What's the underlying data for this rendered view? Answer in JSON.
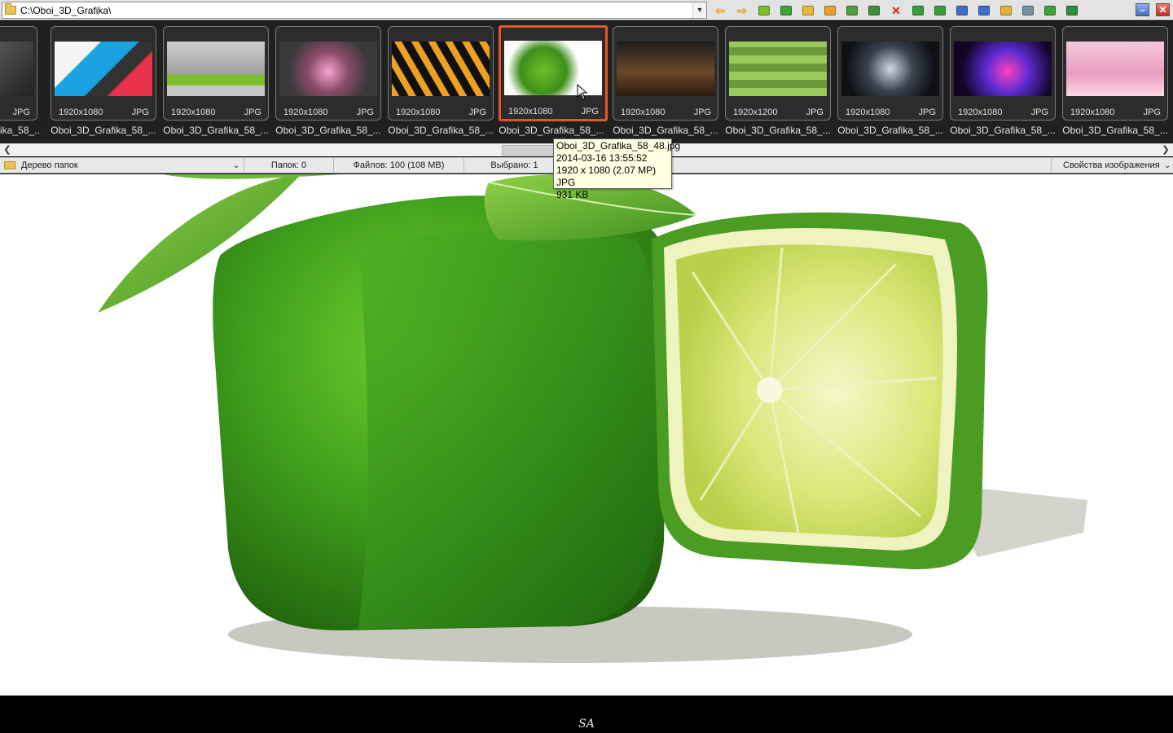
{
  "address_bar": {
    "path": "C:\\Oboi_3D_Grafika\\"
  },
  "toolbar": {
    "buttons": [
      {
        "name": "back-icon",
        "glyph": "⇦",
        "color": "#e0a500"
      },
      {
        "name": "forward-icon",
        "glyph": "⇨",
        "color": "#e0a500"
      },
      {
        "name": "up-folder-icon",
        "glyph": "",
        "color": "#7dbd2e"
      },
      {
        "name": "refresh-icon",
        "glyph": "",
        "color": "#3fa23a"
      },
      {
        "name": "folder-star-icon",
        "glyph": "",
        "color": "#e6b93a"
      },
      {
        "name": "new-folder-icon",
        "glyph": "",
        "color": "#e6a12f"
      },
      {
        "name": "copy-to-icon",
        "glyph": "",
        "color": "#4f9d3a"
      },
      {
        "name": "move-to-icon",
        "glyph": "",
        "color": "#3e8f3a"
      },
      {
        "name": "delete-icon",
        "glyph": "✕",
        "color": "#d8231a"
      },
      {
        "name": "rotate-left-icon",
        "glyph": "",
        "color": "#3c9a3c"
      },
      {
        "name": "rotate-right-icon",
        "glyph": "",
        "color": "#3c9a3c"
      },
      {
        "name": "compare-icon",
        "glyph": "",
        "color": "#3e6fc7"
      },
      {
        "name": "slideshow-icon",
        "glyph": "",
        "color": "#3e6fc7"
      },
      {
        "name": "email-icon",
        "glyph": "",
        "color": "#e0b23a"
      },
      {
        "name": "print-icon",
        "glyph": "",
        "color": "#7a8ea8"
      },
      {
        "name": "settings-icon",
        "glyph": "",
        "color": "#3fa23a"
      },
      {
        "name": "exit-icon",
        "glyph": "",
        "color": "#2f8f3a"
      }
    ]
  },
  "window_buttons": {
    "minimize": "–",
    "close": "✕"
  },
  "thumbnails": [
    {
      "res": "",
      "fmt": "JPG",
      "name": "ika_58_...",
      "selected": false
    },
    {
      "res": "1920x1080",
      "fmt": "JPG",
      "name": "Oboi_3D_Grafika_58_...",
      "selected": false
    },
    {
      "res": "1920x1080",
      "fmt": "JPG",
      "name": "Oboi_3D_Grafika_58_...",
      "selected": false
    },
    {
      "res": "1920x1080",
      "fmt": "JPG",
      "name": "Oboi_3D_Grafika_58_...",
      "selected": false
    },
    {
      "res": "1920x1080",
      "fmt": "JPG",
      "name": "Oboi_3D_Grafika_58_...",
      "selected": false
    },
    {
      "res": "1920x1080",
      "fmt": "JPG",
      "name": "Oboi_3D_Grafika_58_...",
      "selected": true
    },
    {
      "res": "1920x1080",
      "fmt": "JPG",
      "name": "Oboi_3D_Grafika_58_...",
      "selected": false
    },
    {
      "res": "1920x1200",
      "fmt": "JPG",
      "name": "Oboi_3D_Grafika_58_...",
      "selected": false
    },
    {
      "res": "1920x1080",
      "fmt": "JPG",
      "name": "Oboi_3D_Grafika_58_...",
      "selected": false
    },
    {
      "res": "1920x1080",
      "fmt": "JPG",
      "name": "Oboi_3D_Grafika_58_...",
      "selected": false
    },
    {
      "res": "1920x1080",
      "fmt": "JPG",
      "name": "Oboi_3D_Grafika_58_...",
      "selected": false
    }
  ],
  "status": {
    "folder_tree": "Дерево папок",
    "folders": "Папок: 0",
    "files": "Файлов: 100 (108 MB)",
    "selected": "Выбрано: 1",
    "image_props": "Свойства изображения"
  },
  "tooltip": {
    "filename": "Oboi_3D_Grafika_58_48.jpg",
    "date": "2014-03-16 13:55:52",
    "dimensions": "1920 x 1080 (2.07 MP)  JPG",
    "size": "931 KB"
  },
  "signature": "SA"
}
